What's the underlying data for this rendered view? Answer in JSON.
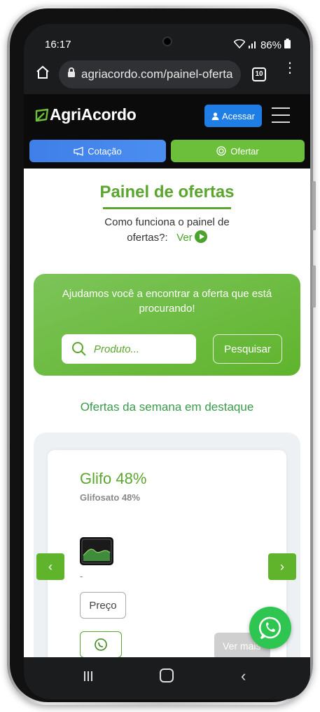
{
  "status": {
    "time": "16:17",
    "battery": "86%"
  },
  "browser": {
    "url": "agriacordo.com/painel-oferta",
    "tab_count": "10"
  },
  "header": {
    "brand": "AgriAcordo",
    "login_label": "Acessar"
  },
  "tabs": {
    "cotacao": "Cotação",
    "ofertar": "Ofertar"
  },
  "main": {
    "title": "Painel de ofertas",
    "how_line1": "Como funciona o painel de",
    "how_line2": "ofertas?:",
    "how_link": "Ver"
  },
  "search": {
    "heading": "Ajudamos você a encontrar a oferta que está procurando!",
    "placeholder": "Produto...",
    "button": "Pesquisar"
  },
  "highlights": {
    "title": "Ofertas da semana em destaque"
  },
  "offer": {
    "name": "Glifo 48%",
    "subtitle": "Glifosato 48%",
    "dash": "-",
    "price_button": "Preço",
    "more_button": "Ver mais"
  },
  "colors": {
    "brand_green": "#5aa62f",
    "blue": "#1e7ee6",
    "whatsapp": "#2ec650"
  }
}
